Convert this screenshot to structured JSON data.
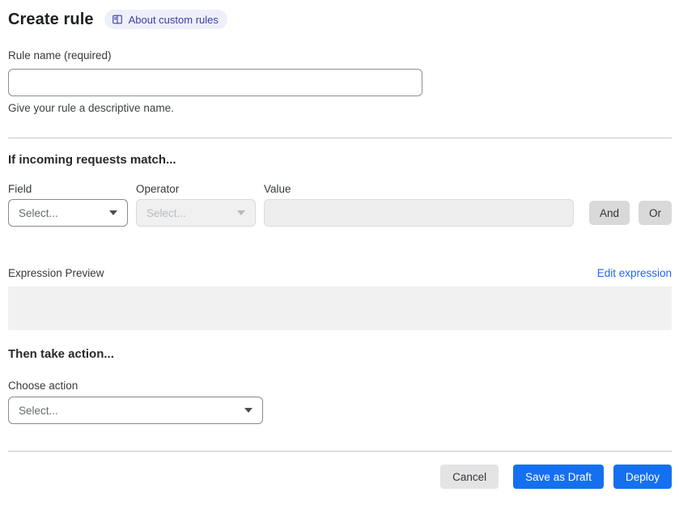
{
  "header": {
    "title": "Create rule",
    "about_badge_label": "About custom rules"
  },
  "rule_name": {
    "label": "Rule name (required)",
    "value": "",
    "helper": "Give your rule a descriptive name."
  },
  "match_section": {
    "heading": "If incoming requests match...",
    "field": {
      "label": "Field",
      "selected": "Select...",
      "enabled": true
    },
    "operator": {
      "label": "Operator",
      "selected": "Select...",
      "enabled": false
    },
    "value": {
      "label": "Value",
      "value": "",
      "enabled": false
    },
    "and_button_label": "And",
    "or_button_label": "Or",
    "expression_preview_label": "Expression Preview",
    "edit_expression_link": "Edit expression",
    "expression_preview_value": ""
  },
  "action_section": {
    "heading": "Then take action...",
    "choose_action_label": "Choose action",
    "action_select": {
      "selected": "Select...",
      "enabled": true
    }
  },
  "footer": {
    "cancel_label": "Cancel",
    "save_as_draft_label": "Save as Draft",
    "deploy_label": "Deploy"
  },
  "icons": {
    "about_badge_icon": "book-icon",
    "select_caret": "caret-down-icon"
  },
  "colors": {
    "primary_blue": "#1570ef",
    "link_blue": "#2065f0",
    "badge_bg": "#edeffa",
    "badge_text": "#3e3ea6",
    "disabled_bg": "#f0f0f0",
    "neutral_button_bg": "#d9d9d9",
    "preview_box_bg": "#f1f1f2"
  }
}
